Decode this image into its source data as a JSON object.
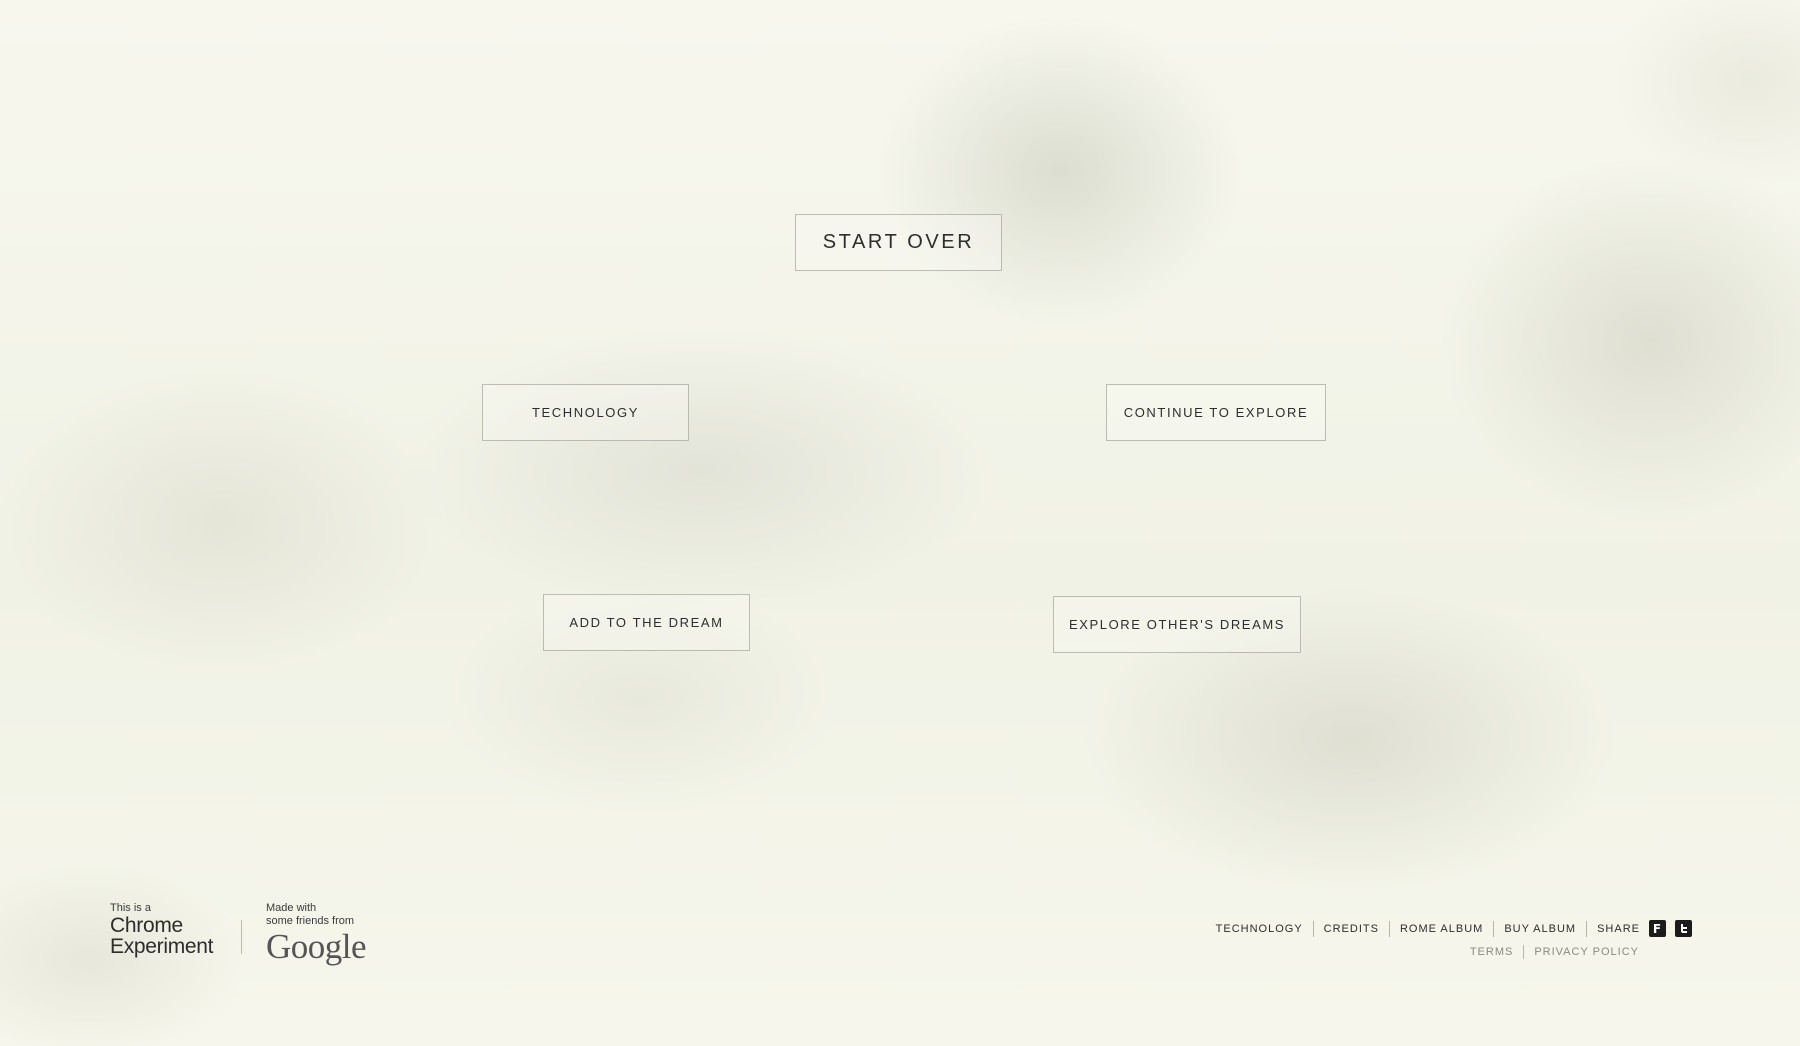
{
  "buttons": {
    "start_over": "START OVER",
    "technology": "TECHNOLOGY",
    "continue_explore": "CONTINUE TO EXPLORE",
    "add_dream": "ADD TO THE DREAM",
    "explore_others": "EXPLORE OTHER'S DREAMS"
  },
  "badge": {
    "intro": "This is a",
    "line1": "Chrome",
    "line2": "Experiment",
    "made_with": "Made with",
    "friends_from": "some friends from",
    "google": "Google"
  },
  "footer": {
    "links": [
      "TECHNOLOGY",
      "CREDITS",
      "ROME ALBUM",
      "BUY ALBUM"
    ],
    "share": "SHARE",
    "social_icons": [
      "facebook-icon",
      "twitter-icon"
    ],
    "legal": [
      "TERMS",
      "PRIVACY POLICY"
    ]
  },
  "colors": {
    "background": "#f6f6ec",
    "text": "#2d2d2d",
    "muted_text": "#8a8a82",
    "border": "#9a9a8f"
  }
}
